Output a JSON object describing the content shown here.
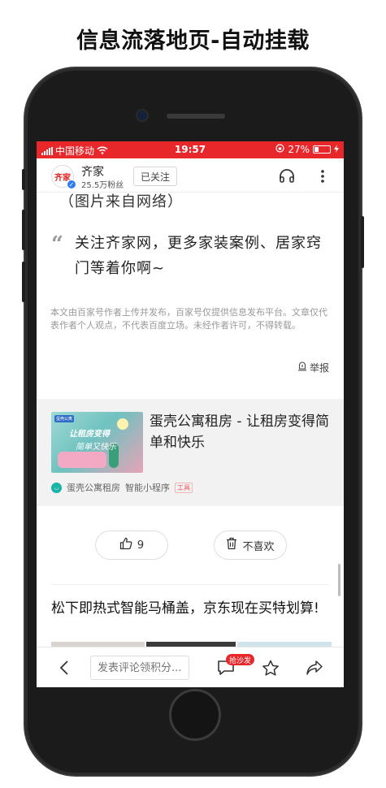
{
  "page": {
    "heading": "信息流落地页-自动挂载"
  },
  "statusbar": {
    "carrier": "中国移动",
    "time": "19:57",
    "battery": "27%",
    "battery_level": 0.27
  },
  "header": {
    "account_name": "齐家",
    "logo_text": "齐家",
    "fans": "25.5万粉丝",
    "follow_label": "已关注",
    "icons": [
      "headphones-icon",
      "more-icon"
    ]
  },
  "article": {
    "cut_line": "（图片来自网络）",
    "quote": "关注齐家网，更多家装案例、居家窍门等着你啊~",
    "disclaimer": "本文由百家号作者上传并发布，百家号仅提供信息发布平台。文章仅代表作者个人观点，不代表百度立场。未经作者许可，不得转载。",
    "report_label": "举报"
  },
  "ad": {
    "thumb_tag": "蛋壳公寓",
    "thumb_line1": "让租房变得",
    "thumb_line2": "简单又快乐",
    "title": "蛋壳公寓租房 - 让租房变得简单和快乐",
    "source": "蛋壳公寓租房",
    "type": "智能小程序",
    "tag": "工具"
  },
  "actions": {
    "like_count": "9",
    "dislike_label": "不喜欢"
  },
  "next_article": {
    "title": "松下即热式智能马桶盖，京东现在买特划算!"
  },
  "bottombar": {
    "comment_placeholder": "发表评论领积分...",
    "sofa_badge": "抢沙发"
  },
  "colors": {
    "accent": "#e8272b",
    "link_blue": "#2f7cf6",
    "ad_bg": "#f2f2f2"
  }
}
